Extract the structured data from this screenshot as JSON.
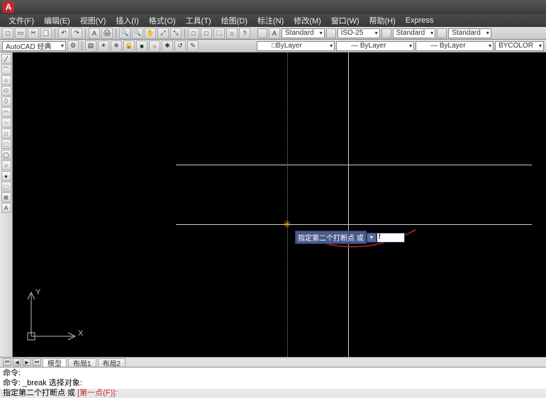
{
  "app": {
    "logo_letter": "A"
  },
  "menu": {
    "items": [
      "文件(F)",
      "编辑(E)",
      "视图(V)",
      "插入(I)",
      "格式(O)",
      "工具(T)",
      "绘图(D)",
      "标注(N)",
      "修改(M)",
      "窗口(W)",
      "帮助(H)",
      "Express"
    ]
  },
  "toolbar1": {
    "buttons": [
      "□",
      "▭",
      "✂",
      "📋",
      "↶",
      "↷",
      "A",
      "🖨",
      "🔍",
      "🔍",
      "✋",
      "⤢",
      "⤡",
      "□",
      "□",
      "⬚",
      "⌂",
      "?",
      "A"
    ],
    "styles": {
      "text_style": "Standard",
      "dim_style": "ISO-25",
      "table_style": "Standard",
      "ml_style": "Standard"
    }
  },
  "toolbar2": {
    "workspace": "AutoCAD 经典",
    "layer_state": "□ByLayer",
    "linetype": "— ByLayer",
    "lineweight": "— ByLayer",
    "plot_style": "BYCOLOR"
  },
  "lefttools": {
    "icons": [
      "╱",
      "⌒",
      "○",
      "⬭",
      "⬯",
      "◠",
      "~",
      "□",
      "⬚",
      "◯",
      "○",
      "●",
      "⬚",
      "⊞",
      "A"
    ]
  },
  "canvas": {
    "prompt_label": "指定第二个打断点 或",
    "prompt_dd": "▾",
    "prompt_value": "f",
    "marker_glyph": "✳",
    "ucs": {
      "x": "X",
      "y": "Y"
    }
  },
  "tabs": {
    "nav": [
      "⏮",
      "◀",
      "▶",
      "⏭"
    ],
    "items": [
      "模型",
      "布局1",
      "布局2"
    ],
    "active_index": 0
  },
  "cmd": {
    "line1": "命令:",
    "line2_a": "命令: _break 选择对象:",
    "line3_a": "指定第二个打断点 或 ",
    "line3_b": "[第一点(F)]:"
  }
}
